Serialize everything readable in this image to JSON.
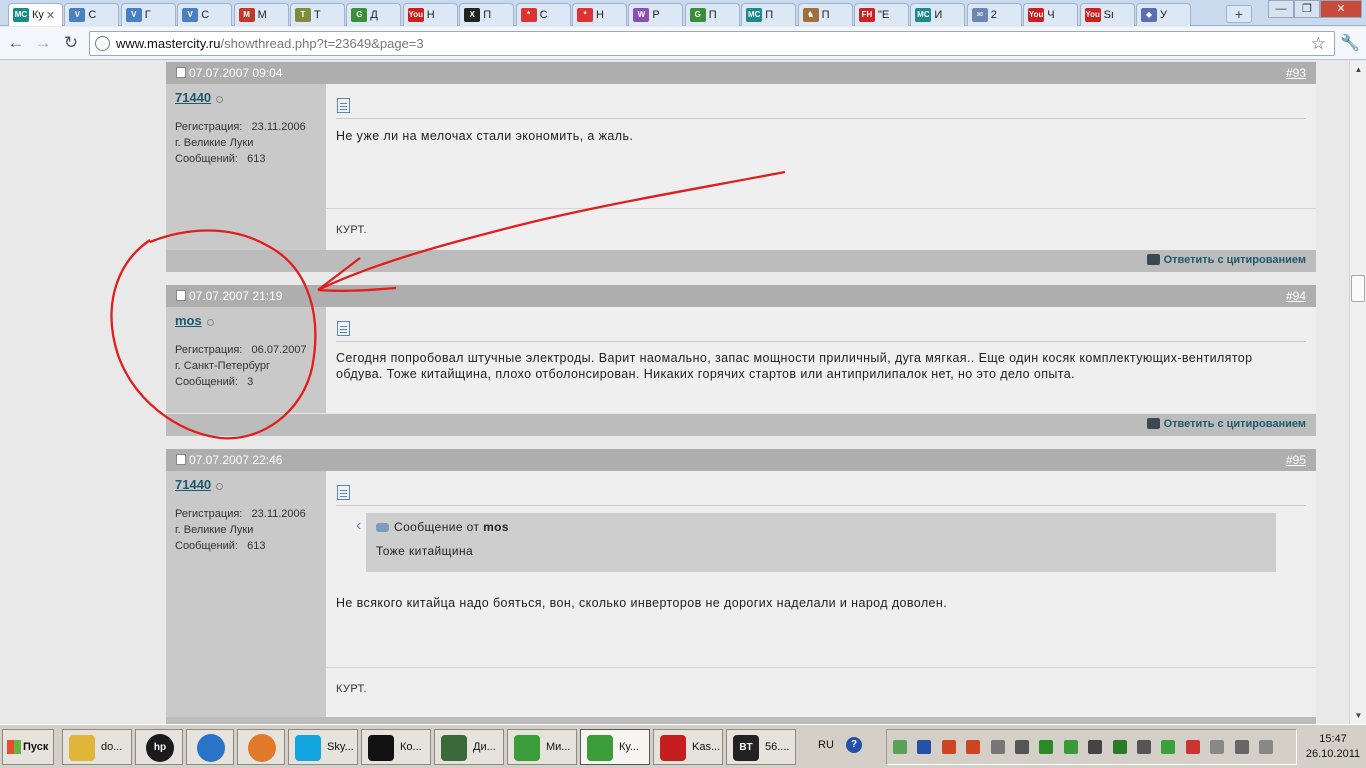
{
  "browser": {
    "tabs": [
      {
        "title": "Ку",
        "fav": "MC",
        "color": "#1a8a8a",
        "active": true
      },
      {
        "title": "С",
        "fav": "V",
        "color": "#4a7fc0"
      },
      {
        "title": "Г",
        "fav": "V",
        "color": "#4a7fc0"
      },
      {
        "title": "С",
        "fav": "V",
        "color": "#4a7fc0"
      },
      {
        "title": "М",
        "fav": "M",
        "color": "#c0392b"
      },
      {
        "title": "Т",
        "fav": "T",
        "color": "#7f8c3d"
      },
      {
        "title": "Д",
        "fav": "G",
        "color": "#3a8f3a"
      },
      {
        "title": "Н",
        "fav": "You",
        "color": "#cc1f1f"
      },
      {
        "title": "П",
        "fav": "X",
        "color": "#222222"
      },
      {
        "title": "С",
        "fav": "*",
        "color": "#d33"
      },
      {
        "title": "Н",
        "fav": "*",
        "color": "#d33"
      },
      {
        "title": "Р",
        "fav": "W",
        "color": "#8a4fb0"
      },
      {
        "title": "П",
        "fav": "G",
        "color": "#3a8f3a"
      },
      {
        "title": "П",
        "fav": "MC",
        "color": "#1a8a8a"
      },
      {
        "title": "П",
        "fav": "♞",
        "color": "#a0703a"
      },
      {
        "title": "\"Е",
        "fav": "FH",
        "color": "#cc2222"
      },
      {
        "title": "И",
        "fav": "MC",
        "color": "#1a8a8a"
      },
      {
        "title": "2",
        "fav": "✉",
        "color": "#6b86b3"
      },
      {
        "title": "Ч",
        "fav": "You",
        "color": "#cc1f1f"
      },
      {
        "title": "Sı",
        "fav": "You",
        "color": "#cc1f1f"
      },
      {
        "title": "У",
        "fav": "◆",
        "color": "#5a6fb0"
      }
    ],
    "tab_close": "✕",
    "new_tab": "+",
    "url_host": "www.mastercity.ru",
    "url_path": "/showthread.php?t=23649&page=3"
  },
  "posts": [
    {
      "date": "07.07.2007 09:04",
      "num": "#93",
      "user": "71440",
      "reg_label": "Регистрация:",
      "reg": "23.11.2006",
      "city": "г. Великие Луки",
      "msgs_label": "Сообщений:",
      "msgs": "613",
      "text": "Не уже ли на мелочах стали экономить, а жаль.",
      "sig": "КУРТ.",
      "reply": "Ответить с цитированием"
    },
    {
      "date": "07.07.2007 21:19",
      "num": "#94",
      "user": "mos",
      "reg_label": "Регистрация:",
      "reg": "06.07.2007",
      "city": "г. Санкт-Петербург",
      "msgs_label": "Сообщений:",
      "msgs": "3",
      "text": "Сегодня попробовал штучные электроды. Варит наомально, запас мощности приличный, дуга мягкая.. Еще один косяк комплектующих-вентилятор обдува. Тоже китайщина, плохо отболонсирован. Никаких горячих стартов или антиприлипалок нет, но это дело опыта.",
      "reply": "Ответить с цитированием"
    },
    {
      "date": "07.07.2007 22:46",
      "num": "#95",
      "user": "71440",
      "reg_label": "Регистрация:",
      "reg": "23.11.2006",
      "city": "г. Великие Луки",
      "msgs_label": "Сообщений:",
      "msgs": "613",
      "quote_prefix": "Сообщение от",
      "quote_author": "mos",
      "quote_text": "Тоже китайщина",
      "text": "Не всякого китайца надо бояться, вон, сколько инверторов не дорогих наделали и народ доволен.",
      "sig": "КУРТ."
    }
  ],
  "taskbar": {
    "start": "Пуск",
    "buttons": [
      {
        "label": "do...",
        "icon": "folder",
        "color": "#e0b63a"
      },
      {
        "label": "",
        "icon": "hp",
        "color": "#1a1a1a"
      },
      {
        "label": "",
        "icon": "ie",
        "color": "#2a74c7"
      },
      {
        "label": "",
        "icon": "media",
        "color": "#e07a2a"
      },
      {
        "label": "Sky...",
        "icon": "skype",
        "color": "#12a5e0"
      },
      {
        "label": "Ко...",
        "icon": "cmd",
        "color": "#111111"
      },
      {
        "label": "Ди...",
        "icon": "monitor",
        "color": "#3a6a3a"
      },
      {
        "label": "Ми...",
        "icon": "chrome",
        "color": "#3a9d3a"
      },
      {
        "label": "Ку...",
        "icon": "chrome",
        "color": "#3a9d3a",
        "pressed": true
      },
      {
        "label": "Kas...",
        "icon": "kaspersky",
        "color": "#c41e1e"
      },
      {
        "label": "56....",
        "icon": "bt",
        "color": "#222222"
      }
    ],
    "lang": "RU",
    "time": "15:47",
    "date": "26.10.2011"
  }
}
